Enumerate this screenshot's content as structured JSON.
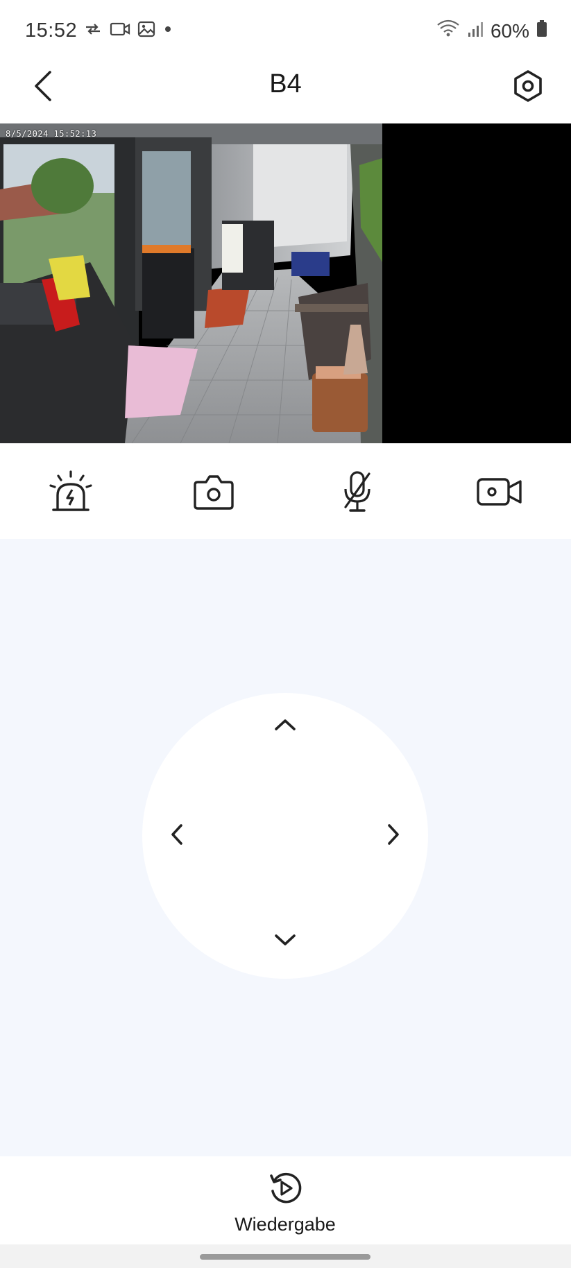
{
  "status_bar": {
    "time": "15:52",
    "battery": "60%",
    "icons": [
      "transfer-arrows-icon",
      "video-camera-icon",
      "gallery-icon",
      "dot-icon",
      "wifi-icon",
      "signal-icon",
      "battery-icon"
    ]
  },
  "app_bar": {
    "title": "B4",
    "back_icon": "chevron-left-icon",
    "settings_icon": "hexagon-settings-icon"
  },
  "video": {
    "timestamp": "8/5/2024  15:52:13"
  },
  "controls": {
    "items": [
      {
        "name": "alarm-siren",
        "icon": "siren-icon"
      },
      {
        "name": "snapshot",
        "icon": "camera-icon"
      },
      {
        "name": "microphone",
        "icon": "mic-muted-icon"
      },
      {
        "name": "record",
        "icon": "video-camera-icon"
      }
    ]
  },
  "ptz": {
    "directions": [
      "up",
      "down",
      "left",
      "right"
    ]
  },
  "bottom": {
    "playback_label": "Wiedergabe",
    "playback_icon": "replay-icon"
  },
  "colors": {
    "background": "#ffffff",
    "ptz_background": "#f4f7fd",
    "icon": "#222222"
  }
}
